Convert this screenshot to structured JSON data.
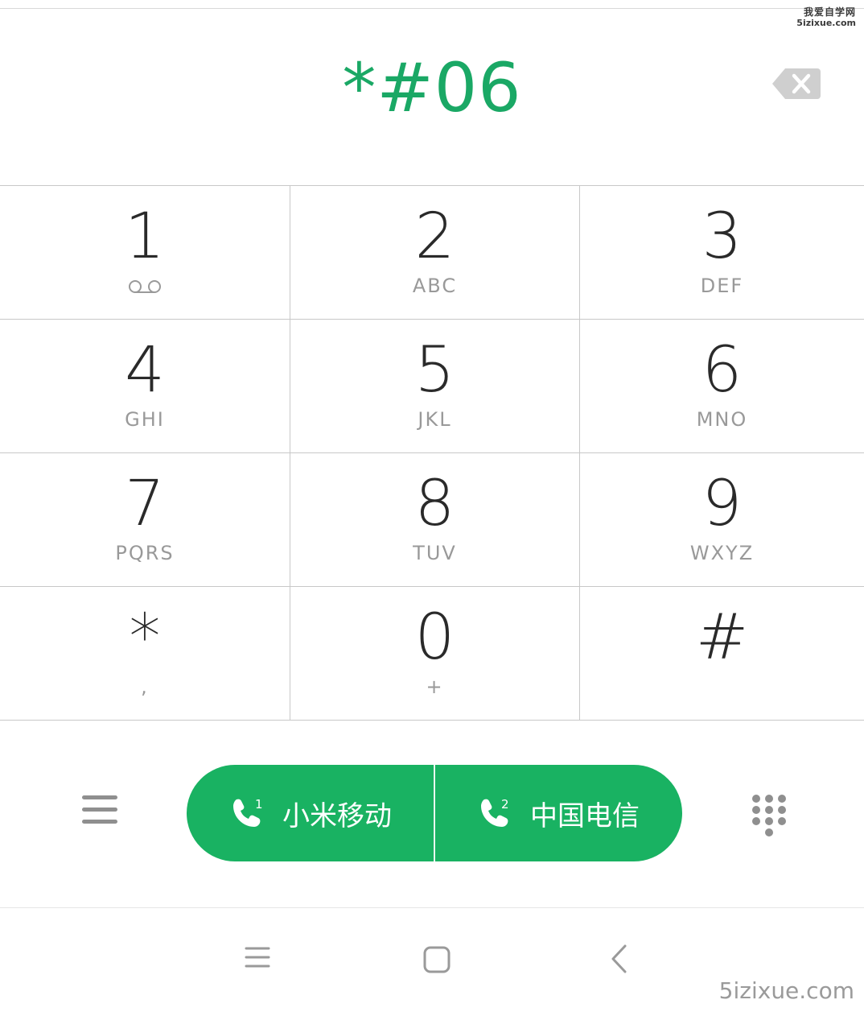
{
  "watermark": {
    "top_line1": "我爱自学网",
    "top_line2": "5izixue.com",
    "bottom": "5izixue.com"
  },
  "dialer": {
    "input_value": "*#06"
  },
  "keys": [
    {
      "digit": "1",
      "sub": ""
    },
    {
      "digit": "2",
      "sub": "ABC"
    },
    {
      "digit": "3",
      "sub": "DEF"
    },
    {
      "digit": "4",
      "sub": "GHI"
    },
    {
      "digit": "5",
      "sub": "JKL"
    },
    {
      "digit": "6",
      "sub": "MNO"
    },
    {
      "digit": "7",
      "sub": "PQRS"
    },
    {
      "digit": "8",
      "sub": "TUV"
    },
    {
      "digit": "9",
      "sub": "WXYZ"
    },
    {
      "digit": "*",
      "sub": ","
    },
    {
      "digit": "0",
      "sub": "+"
    },
    {
      "digit": "#",
      "sub": ""
    }
  ],
  "call_buttons": {
    "sim1": {
      "label": "小米移动",
      "sim_number": "1"
    },
    "sim2": {
      "label": "中国电信",
      "sim_number": "2"
    }
  },
  "icons": {
    "backspace": "backspace-icon",
    "voicemail": "voicemail-icon",
    "menu": "menu-icon",
    "dialpad": "dialpad-icon",
    "phone": "phone-icon",
    "nav_recents": "nav-menu-icon",
    "nav_home": "nav-home-icon",
    "nav_back": "nav-back-icon"
  },
  "colors": {
    "accent": "#1aa865",
    "call_green": "#19b262",
    "digit": "#2a2a2a",
    "sub_text": "#999999"
  }
}
